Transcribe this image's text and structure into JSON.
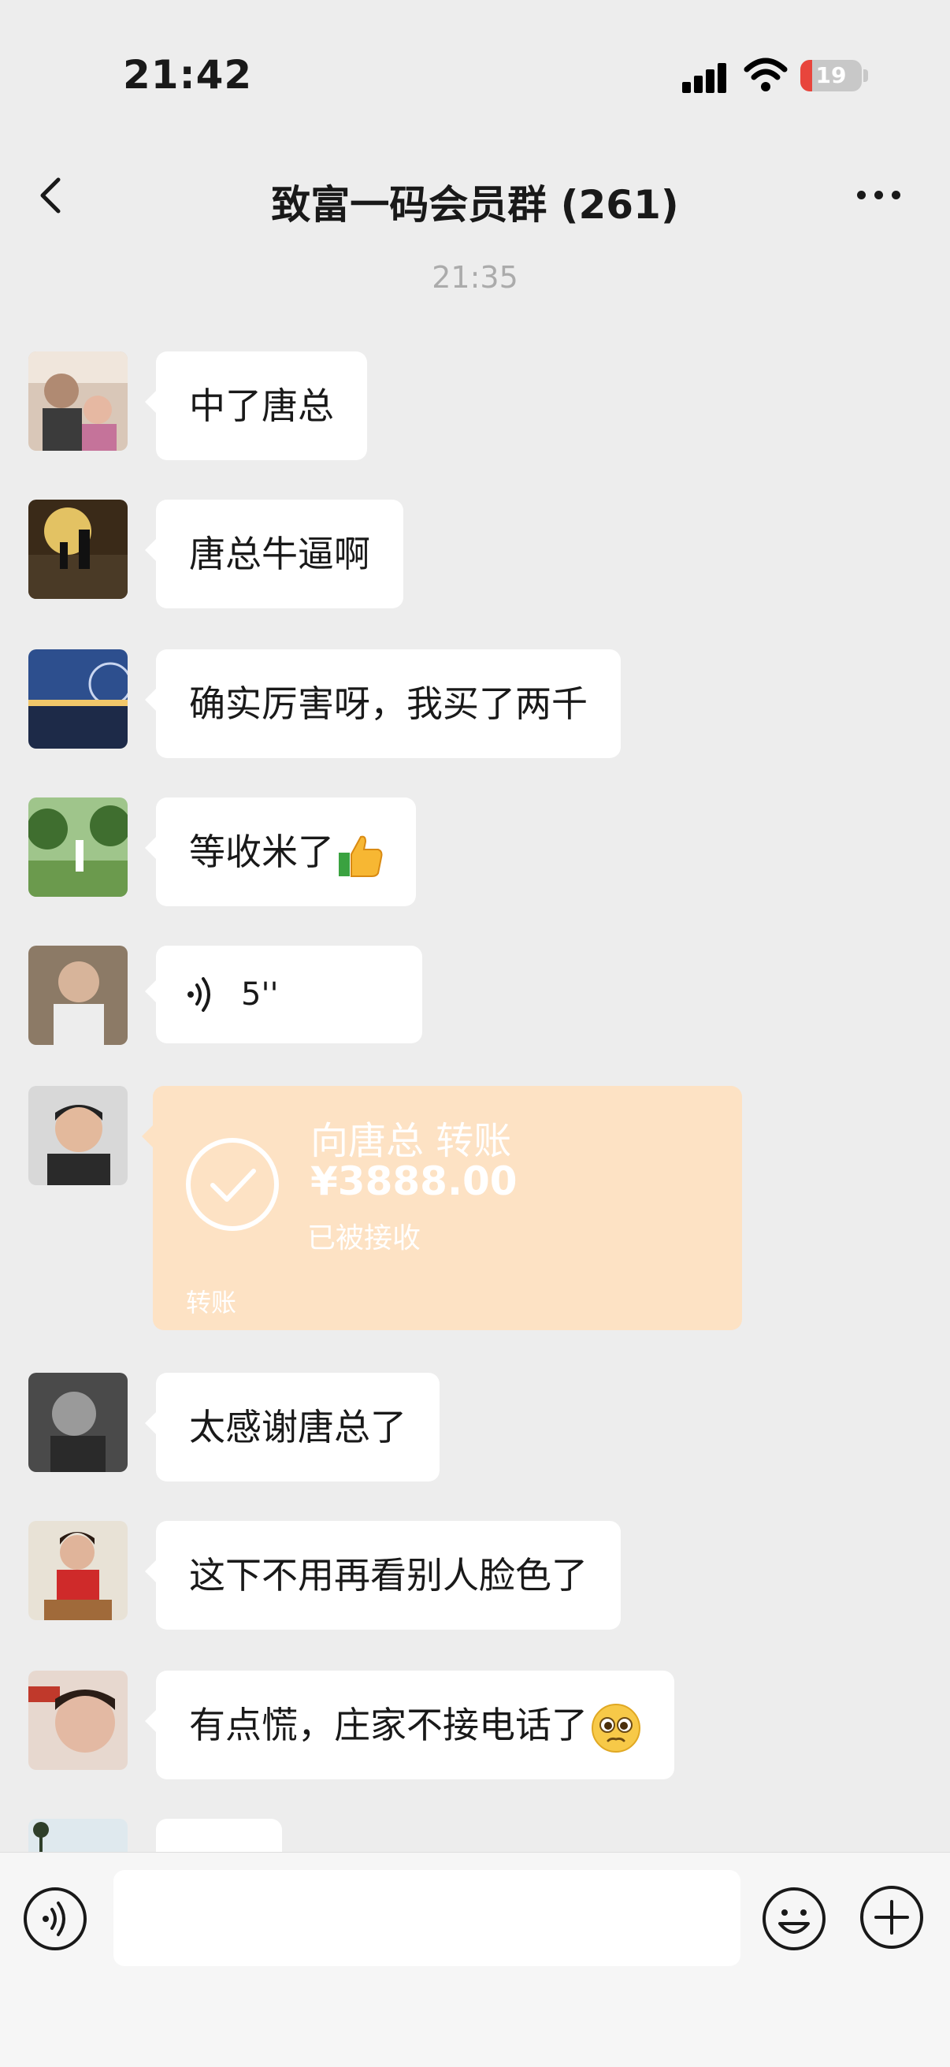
{
  "status_bar": {
    "time": "21:42",
    "battery": "19",
    "battery_fraction": 0.19
  },
  "header": {
    "title": "致富一码会员群 (261)"
  },
  "timestamp": "21:35",
  "messages": [
    {
      "type": "text",
      "text": "中了唐总"
    },
    {
      "type": "text",
      "text": "唐总牛逼啊"
    },
    {
      "type": "text",
      "text": "确实厉害呀，我买了两千"
    },
    {
      "type": "text",
      "text": "等收米了",
      "emoji": "thumbs-up"
    },
    {
      "type": "voice",
      "duration": "5''"
    },
    {
      "type": "transfer",
      "title": "向唐总 转账",
      "amount": "¥3888.00",
      "status": "已被接收",
      "label": "转账"
    },
    {
      "type": "text",
      "text": "太感谢唐总了"
    },
    {
      "type": "text",
      "text": "这下不用再看别人脸色了"
    },
    {
      "type": "text",
      "text": "有点慌，庄家不接电话了",
      "emoji": "pleading-face"
    },
    {
      "type": "text",
      "text": ""
    }
  ],
  "input_bar": {
    "placeholder": ""
  },
  "colors": {
    "background": "#ededed",
    "bubble": "#ffffff",
    "transfer_accepted": "#fde2c4",
    "battery_low": "#e8453c"
  },
  "icons": [
    "back-arrow",
    "more-dots",
    "voice-wave",
    "check-circle",
    "thumbs-up",
    "pleading-face",
    "smiley",
    "plus-circle"
  ]
}
